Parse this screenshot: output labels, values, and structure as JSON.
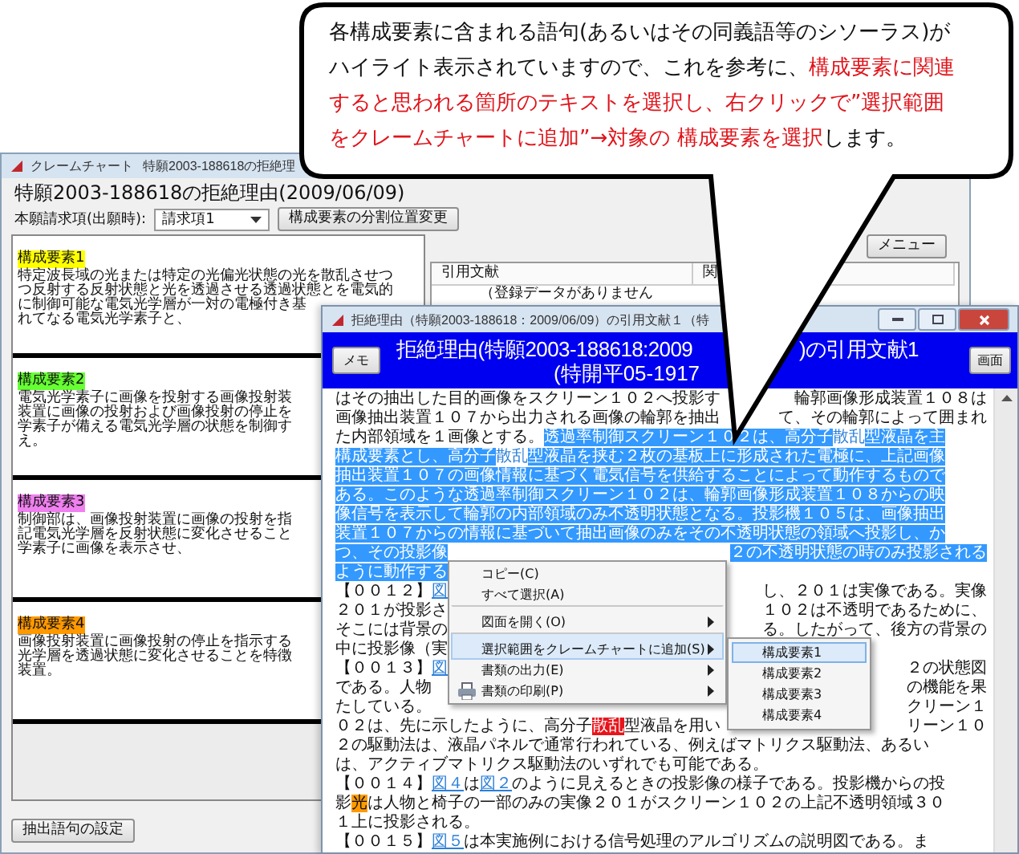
{
  "callout": {
    "segments": [
      {
        "text": "各構成要素に含まれる語句(あるいはその同義語等のシソーラス)がハイライト表示されていますので、これを参考に、",
        "emphasis": false
      },
      {
        "text": "構成要素に関連すると思われる箇所のテキストを選択し、右クリックで”選択範囲をクレームチャートに追加”→対象の 構成要素を選択",
        "emphasis": true
      },
      {
        "text": "します。",
        "emphasis": false
      }
    ]
  },
  "claim_chart_window": {
    "title": "クレームチャート",
    "title_detail": "特願2003-188618の拒絶理",
    "heading": "特願2003-188618の拒絶理由(2009/06/09)",
    "claim_label": "本願請求項(出願時):",
    "claim_select": "請求項1",
    "split_button": "構成要素の分割位置変更",
    "menu_button": "メニュー",
    "elements": [
      {
        "label": "構成要素1",
        "color": "#ffff00",
        "lines": [
          "特定波長域の光または特定の光偏光状態の光を散乱させつ",
          "つ反射する反射状態と光を透過させる透過状態とを電気的",
          "に制御可能な電気光学層が一対の電極付き基",
          "れてなる電気光学素子と、"
        ]
      },
      {
        "label": "構成要素2",
        "color": "#66ff33",
        "lines": [
          "電気光学素子に画像を投射する画像投射装",
          "装置に画像の投射および画像投射の停止を",
          "学素子が備える電気光学層の状態を制御す",
          "え。"
        ]
      },
      {
        "label": "構成要素3",
        "color": "#f080f0",
        "lines": [
          "制御部は、画像投射装置に画像の投射を指",
          "記電気光学層を反射状態に変化させること",
          "学素子に画像を表示させ、"
        ]
      },
      {
        "label": "構成要素4",
        "color": "#ff9900",
        "lines": [
          "画像投射装置に画像投射の停止を指示する",
          "光学層を透過状態に変化させることを特徴",
          "装置。"
        ]
      }
    ],
    "extract_button": "抽出語句の設定",
    "citation_table": {
      "columns": [
        "引用文献",
        "関"
      ],
      "rows": [
        [
          "（登録データがありません"
        ]
      ]
    }
  },
  "citation_window": {
    "title": "拒絶理由（特願2003-188618：2009/06/09）の引用文献１（特",
    "memo_button": "メモ",
    "screen_button": "画面",
    "heading_a": "拒絶理由(特願2003-188618:2009",
    "heading_b": ")の引用文献1",
    "heading_line2": "(特開平05-1917",
    "lines": [
      {
        "left": [
          {
            "text": "はその抽出した目的画像をスクリーン１０２へ投影す",
            "kind": "normal"
          }
        ],
        "right": [
          {
            "text": "輪郭画像形成装置１０８は",
            "kind": "normal"
          }
        ]
      },
      {
        "left": [
          {
            "text": "画像抽出装置１０７から出力される画像の輪郭を抽出",
            "kind": "normal"
          }
        ],
        "right": [
          {
            "text": "て、その輪郭によって囲まれ",
            "kind": "normal"
          }
        ]
      },
      {
        "left": [
          {
            "text": "た内部領域を１画像とする。",
            "kind": "normal"
          },
          {
            "text": "透過率制御スクリーン１０２は、高分子",
            "kind": "selected"
          },
          {
            "text": "散乱",
            "kind": "term"
          },
          {
            "text": "型液晶を主",
            "kind": "selected"
          }
        ]
      },
      {
        "left": [
          {
            "text": "構成要素とし、高分子",
            "kind": "selected"
          },
          {
            "text": "散乱",
            "kind": "term"
          },
          {
            "text": "型液晶を挟む２枚の基板上に形成された電極に、上記画像",
            "kind": "selected"
          }
        ]
      },
      {
        "left": [
          {
            "text": "抽出装置１０７の画像情報に基づく電気信号を供給することによって動作するもので",
            "kind": "selected"
          }
        ]
      },
      {
        "left": [
          {
            "text": "ある。このような透過率制御スクリーン１０２は、輪郭画像形成装置１０８からの映",
            "kind": "selected"
          }
        ]
      },
      {
        "left": [
          {
            "text": "像信号を表示して輪郭の内部領域のみ不透明状態となる。投影機１０５は、画像抽出",
            "kind": "selected"
          }
        ]
      },
      {
        "left": [
          {
            "text": "装置１０７からの情報に基づいて抽出画像のみをその不透明状態の領域へ投影し、か",
            "kind": "selected"
          }
        ]
      },
      {
        "left": [
          {
            "text": "つ、その投影像",
            "kind": "selected"
          }
        ],
        "right": [
          {
            "text": "２の不透明状態の時のみ投影される",
            "kind": "selected"
          }
        ]
      },
      {
        "left": [
          {
            "text": "ように動作する",
            "kind": "selected"
          }
        ]
      },
      {
        "left": [
          {
            "text": "【００１２】",
            "kind": "normal"
          },
          {
            "text": "図",
            "kind": "link"
          }
        ],
        "right": [
          {
            "text": "し、２０１は実像である。実像",
            "kind": "normal"
          }
        ]
      },
      {
        "left": [
          {
            "text": "２０１が投影さ",
            "kind": "normal"
          }
        ],
        "right": [
          {
            "text": "１０２は不透明であるために、",
            "kind": "normal"
          }
        ]
      },
      {
        "left": [
          {
            "text": "そこには背景の",
            "kind": "normal"
          }
        ],
        "right": [
          {
            "text": "る。したがって、後方の背景の",
            "kind": "normal"
          }
        ]
      },
      {
        "left": [
          {
            "text": "中に投影像（実",
            "kind": "normal"
          }
        ]
      },
      {
        "left": [
          {
            "text": "【００１３】",
            "kind": "normal"
          },
          {
            "text": "図",
            "kind": "link"
          }
        ],
        "right": [
          {
            "text": "２の状態図",
            "kind": "normal"
          }
        ]
      },
      {
        "left": [
          {
            "text": "である。人物",
            "kind": "normal"
          }
        ],
        "right": [
          {
            "text": "の機能を果",
            "kind": "normal"
          }
        ]
      },
      {
        "left": [
          {
            "text": "たしている。",
            "kind": "normal"
          }
        ],
        "right": [
          {
            "text": "クリーン１",
            "kind": "normal"
          }
        ]
      },
      {
        "left": [
          {
            "text": "０２は、先に示したように、高分子",
            "kind": "normal"
          },
          {
            "text": "散乱",
            "kind": "hit"
          },
          {
            "text": "型液晶を用い",
            "kind": "normal"
          }
        ],
        "right": [
          {
            "text": "リーン１０",
            "kind": "normal"
          }
        ]
      },
      {
        "left": [
          {
            "text": "２の駆動法は、液晶パネルで通常行われている、例えばマトリクス駆動法、あるい",
            "kind": "normal"
          }
        ]
      },
      {
        "left": [
          {
            "text": "は、アクティブマトリクス駆動法のいずれでも可能である。",
            "kind": "normal"
          }
        ]
      },
      {
        "left": [
          {
            "text": "【００１４】",
            "kind": "normal"
          },
          {
            "text": "図４",
            "kind": "link"
          },
          {
            "text": "は",
            "kind": "normal"
          },
          {
            "text": "図２",
            "kind": "link"
          },
          {
            "text": "のように見えるときの投影像の様子である。投影機からの投",
            "kind": "normal"
          }
        ]
      },
      {
        "left": [
          {
            "text": "影",
            "kind": "normal"
          },
          {
            "text": "光",
            "kind": "hit-orange"
          },
          {
            "text": "は人物と椅子の一部のみの実像２０１がスクリーン１０２の上記不透明領域３０",
            "kind": "normal"
          }
        ]
      },
      {
        "left": [
          {
            "text": "１上に投影される。",
            "kind": "normal"
          }
        ]
      },
      {
        "left": [
          {
            "text": "【００１５】",
            "kind": "normal"
          },
          {
            "text": "図５",
            "kind": "link"
          },
          {
            "text": "は本実施例における信号処理のアルゴリズムの説明図である。ま",
            "kind": "normal"
          }
        ]
      }
    ],
    "context_menu": [
      {
        "label": "コピー(C)",
        "separator_before": false,
        "submenu": false,
        "selected": false,
        "has_icon": false
      },
      {
        "label": "すべて選択(A)",
        "separator_before": false,
        "submenu": false,
        "selected": false,
        "has_icon": false
      },
      {
        "label": "図面を開く(O)",
        "separator_before": true,
        "submenu": true,
        "selected": false,
        "has_icon": false
      },
      {
        "label": "選択範囲をクレームチャートに追加(S)",
        "separator_before": true,
        "submenu": true,
        "selected": true,
        "has_icon": false
      },
      {
        "label": "書類の出力(E)",
        "separator_before": false,
        "submenu": true,
        "selected": false,
        "has_icon": false
      },
      {
        "label": "書類の印刷(P)",
        "separator_before": false,
        "submenu": true,
        "selected": false,
        "has_icon": true
      }
    ],
    "submenu": [
      {
        "label": "構成要素1",
        "selected": true
      },
      {
        "label": "構成要素2",
        "selected": false
      },
      {
        "label": "構成要素3",
        "selected": false
      },
      {
        "label": "構成要素4",
        "selected": false
      }
    ]
  }
}
